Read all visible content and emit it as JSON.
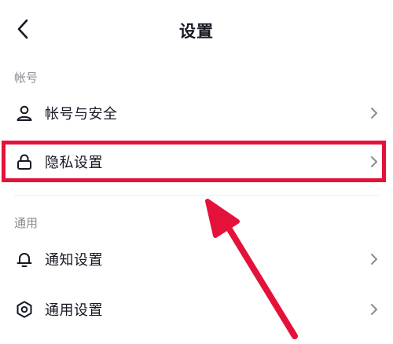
{
  "header": {
    "title": "设置"
  },
  "sections": [
    {
      "label": "帐号",
      "items": [
        {
          "label": "帐号与安全",
          "icon": "user-icon"
        },
        {
          "label": "隐私设置",
          "icon": "lock-icon"
        }
      ]
    },
    {
      "label": "通用",
      "items": [
        {
          "label": "通知设置",
          "icon": "bell-icon"
        },
        {
          "label": "通用设置",
          "icon": "gear-icon"
        }
      ]
    }
  ],
  "annotation": {
    "color": "#e4123b",
    "highlighted_item": "隐私设置"
  }
}
